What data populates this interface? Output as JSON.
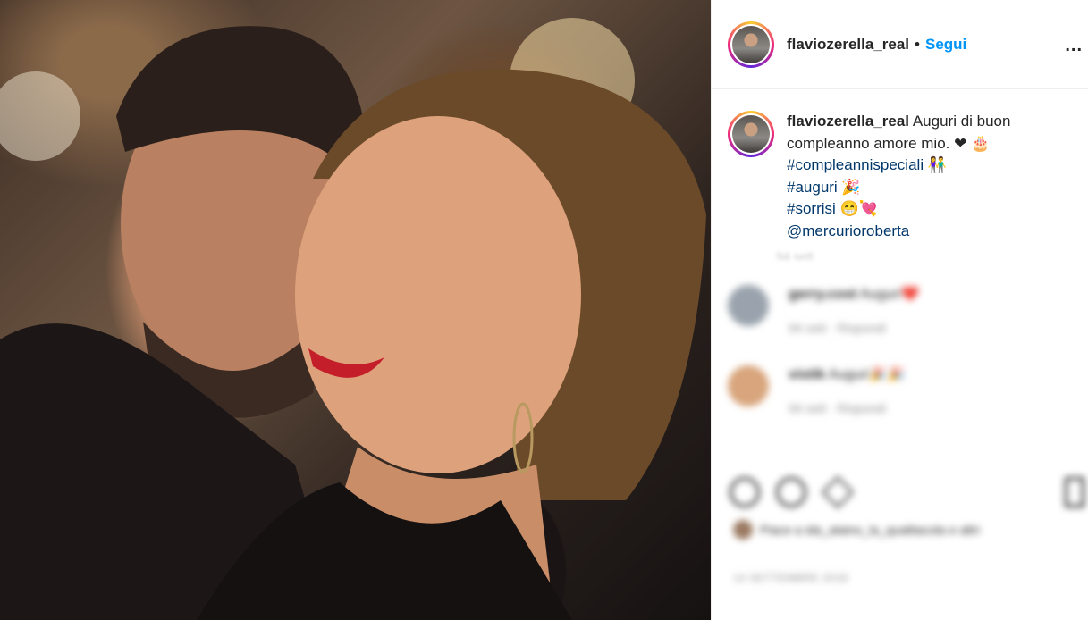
{
  "post": {
    "username": "flaviozerella_real",
    "separator": "•",
    "follow_label": "Segui",
    "more_label": "..."
  },
  "caption": {
    "username": "flaviozerella_real",
    "text": "Auguri di buon compleanno amore mio. ❤ 🎂",
    "lines": [
      "#compleannispeciali 👫",
      "#auguri 🎉",
      "#sorrisi 😁💘",
      "@mercurioroberta"
    ],
    "time": "94 sett"
  },
  "comments": [
    {
      "username": "gerry.cost",
      "text": "Auguri❤️",
      "meta": "94 sett · Rispondi",
      "avatar_color": "#9aa3ad"
    },
    {
      "username": "vistik",
      "text": "Auguri🎉🎉",
      "meta": "94 sett · Rispondi",
      "avatar_color": "#d8a57c"
    }
  ],
  "likes": {
    "text": "Piace a ida_alaino_la_qualitacola e altri"
  },
  "date": "14 SETTEMBRE 2018",
  "colors": {
    "follow": "#0095f6",
    "hashtag": "#00376b",
    "border": "#efefef"
  },
  "icons": [
    "more-icon",
    "heart-icon",
    "comment-icon",
    "share-icon",
    "bookmark-icon"
  ]
}
